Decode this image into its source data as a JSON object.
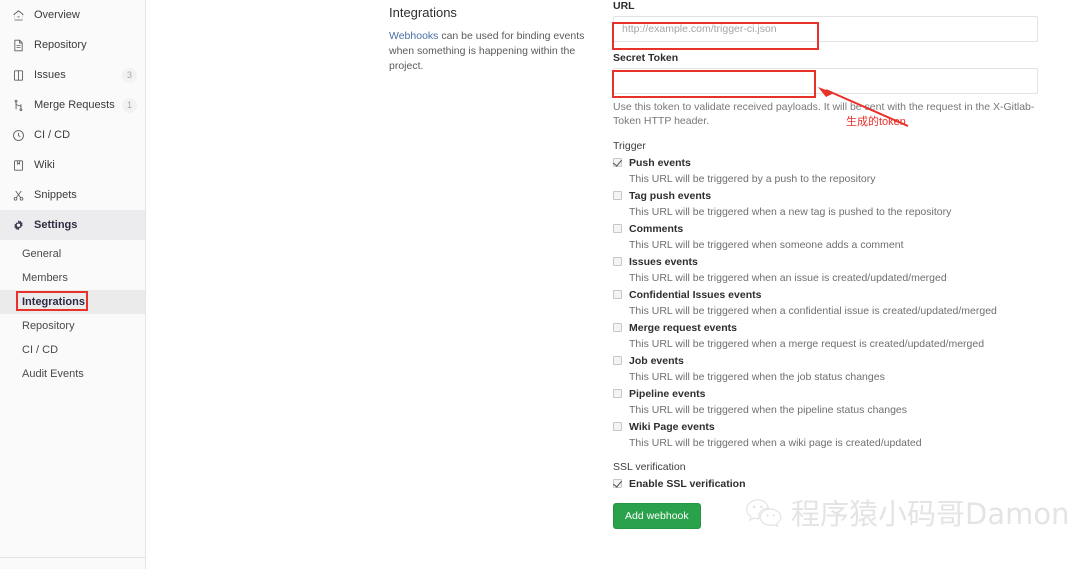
{
  "sidebar": {
    "items": [
      {
        "label": "Overview",
        "icon": "home-icon",
        "badge": ""
      },
      {
        "label": "Repository",
        "icon": "document-icon",
        "badge": ""
      },
      {
        "label": "Issues",
        "icon": "issues-icon",
        "badge": "3"
      },
      {
        "label": "Merge Requests",
        "icon": "merge-request-icon",
        "badge": "1"
      },
      {
        "label": "CI / CD",
        "icon": "rocket-icon",
        "badge": ""
      },
      {
        "label": "Wiki",
        "icon": "book-icon",
        "badge": ""
      },
      {
        "label": "Snippets",
        "icon": "scissors-icon",
        "badge": ""
      },
      {
        "label": "Settings",
        "icon": "gear-icon",
        "badge": ""
      }
    ],
    "subitems": [
      {
        "label": "General"
      },
      {
        "label": "Members"
      },
      {
        "label": "Integrations"
      },
      {
        "label": "Repository"
      },
      {
        "label": "CI / CD"
      },
      {
        "label": "Audit Events"
      }
    ],
    "active_item": "Settings",
    "current_subitem": "Integrations"
  },
  "description": {
    "title": "Integrations",
    "link_text": "Webhooks",
    "body_text": " can be used for binding events when something is happening within the project."
  },
  "form": {
    "url_label": "URL",
    "url_placeholder": "http://example.com/trigger-ci.json",
    "url_value": "",
    "secret_label": "Secret Token",
    "secret_value": "",
    "secret_placeholder": "",
    "secret_hint": "Use this token to validate received payloads. It will be sent with the request in the X-Gitlab-Token HTTP header.",
    "trigger_label": "Trigger",
    "triggers": [
      {
        "label": "Push events",
        "checked": true,
        "desc": "This URL will be triggered by a push to the repository"
      },
      {
        "label": "Tag push events",
        "checked": false,
        "desc": "This URL will be triggered when a new tag is pushed to the repository"
      },
      {
        "label": "Comments",
        "checked": false,
        "desc": "This URL will be triggered when someone adds a comment"
      },
      {
        "label": "Issues events",
        "checked": false,
        "desc": "This URL will be triggered when an issue is created/updated/merged"
      },
      {
        "label": "Confidential Issues events",
        "checked": false,
        "desc": "This URL will be triggered when a confidential issue is created/updated/merged"
      },
      {
        "label": "Merge request events",
        "checked": false,
        "desc": "This URL will be triggered when a merge request is created/updated/merged"
      },
      {
        "label": "Job events",
        "checked": false,
        "desc": "This URL will be triggered when the job status changes"
      },
      {
        "label": "Pipeline events",
        "checked": false,
        "desc": "This URL will be triggered when the pipeline status changes"
      },
      {
        "label": "Wiki Page events",
        "checked": false,
        "desc": "This URL will be triggered when a wiki page is created/updated"
      }
    ],
    "ssl_section_label": "SSL verification",
    "ssl_checkbox_label": "Enable SSL verification",
    "ssl_checked": true,
    "submit_label": "Add webhook"
  },
  "annotations": {
    "arrow_note": "生成的token",
    "color": "#e8312a"
  },
  "watermark": {
    "text": "程序猿小码哥Damon",
    "logo": "wechat-icon"
  }
}
